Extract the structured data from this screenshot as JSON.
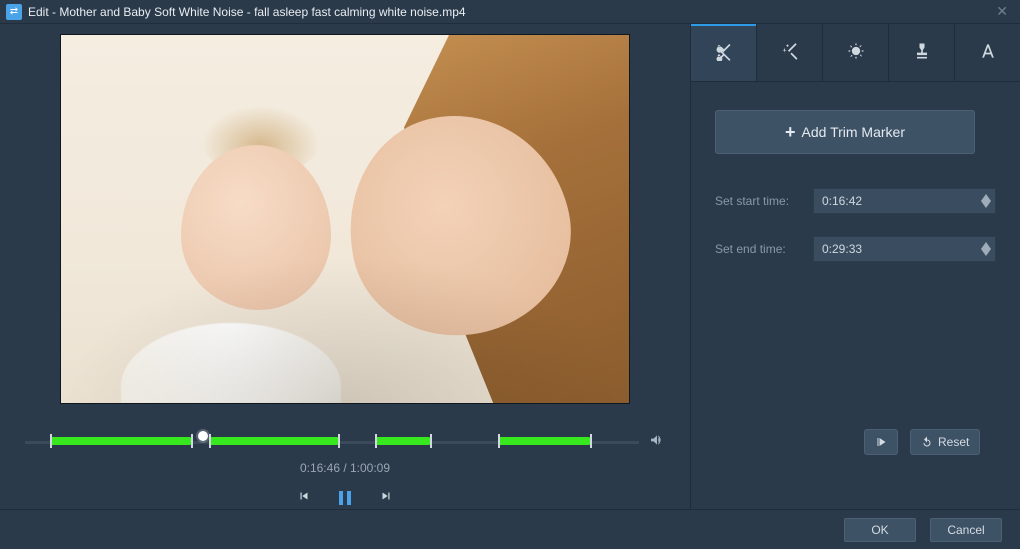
{
  "window": {
    "title": "Edit - Mother and Baby Soft White Noise - fall asleep fast  calming white noise.mp4"
  },
  "player": {
    "time_display": "0:16:46 / 1:00:09"
  },
  "trim_panel": {
    "add_marker_label": "Add Trim Marker",
    "start_label": "Set start time:",
    "start_value": "0:16:42",
    "end_label": "Set end time:",
    "end_value": "0:29:33",
    "reset_label": "Reset"
  },
  "footer": {
    "ok_label": "OK",
    "cancel_label": "Cancel"
  },
  "timeline": {
    "segments": [
      {
        "left_pct": 4,
        "width_pct": 23
      },
      {
        "left_pct": 30,
        "width_pct": 21
      },
      {
        "left_pct": 57,
        "width_pct": 9
      },
      {
        "left_pct": 77,
        "width_pct": 15
      }
    ],
    "playhead_pct": 29
  }
}
